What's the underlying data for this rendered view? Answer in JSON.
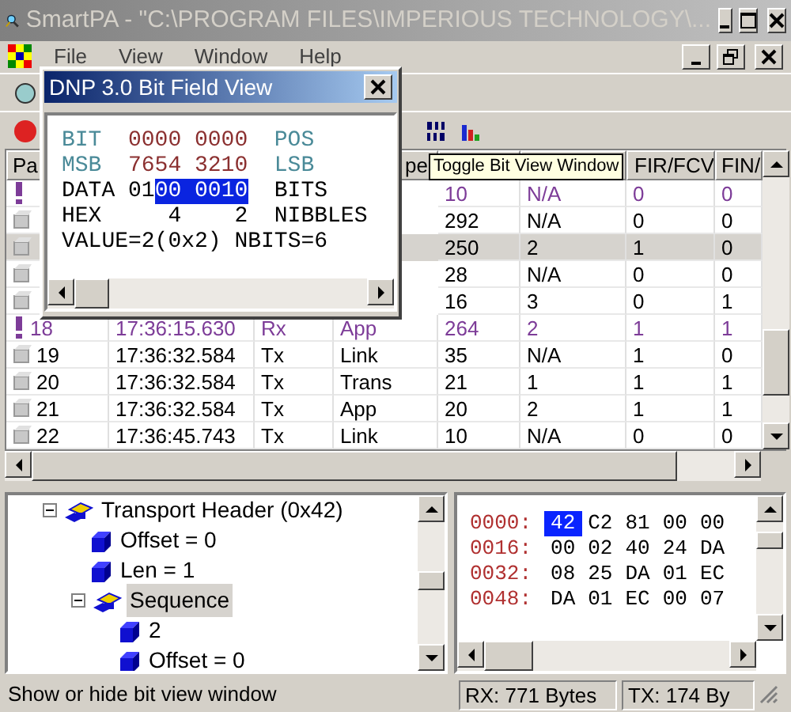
{
  "window": {
    "title": "SmartPA - \"C:\\PROGRAM FILES\\IMPERIOUS TECHNOLOGY\\...",
    "active": false
  },
  "menu": [
    "File",
    "View",
    "Window",
    "Help"
  ],
  "packet_list": {
    "columns": [
      {
        "label": "Pa"
      },
      {},
      {},
      {
        "label": "pe"
      },
      {},
      {},
      {
        "label": "FIR/FCV"
      },
      {
        "label": "FIN/"
      }
    ],
    "rows": [
      {
        "kind": "rx",
        "selected": false,
        "length": "10",
        "sequence": "N/A",
        "fir_fcv": "0",
        "fin": "0"
      },
      {
        "kind": "tx",
        "selected": false,
        "length": "292",
        "sequence": "N/A",
        "fir_fcv": "0",
        "fin": "0"
      },
      {
        "kind": "tx",
        "selected": true,
        "length": "250",
        "sequence": "2",
        "fir_fcv": "1",
        "fin": "0"
      },
      {
        "kind": "tx",
        "selected": false,
        "length": "28",
        "sequence": "N/A",
        "fir_fcv": "0",
        "fin": "0"
      },
      {
        "kind": "tx",
        "selected": false,
        "length": "16",
        "sequence": "3",
        "fir_fcv": "0",
        "fin": "1"
      },
      {
        "kind": "rx",
        "selected": false,
        "number": "18",
        "time": "17:36:15.630",
        "direction": "Rx",
        "layer": "App",
        "length": "264",
        "sequence": "2",
        "fir_fcv": "1",
        "fin": "1"
      },
      {
        "kind": "tx",
        "selected": false,
        "number": "19",
        "time": "17:36:32.584",
        "direction": "Tx",
        "layer": "Link",
        "length": "35",
        "sequence": "N/A",
        "fir_fcv": "1",
        "fin": "0"
      },
      {
        "kind": "tx",
        "selected": false,
        "number": "20",
        "time": "17:36:32.584",
        "direction": "Tx",
        "layer": "Trans",
        "length": "21",
        "sequence": "1",
        "fir_fcv": "1",
        "fin": "1"
      },
      {
        "kind": "tx",
        "selected": false,
        "number": "21",
        "time": "17:36:32.584",
        "direction": "Tx",
        "layer": "App",
        "length": "20",
        "sequence": "2",
        "fir_fcv": "1",
        "fin": "1"
      },
      {
        "kind": "tx",
        "selected": false,
        "number": "22",
        "time": "17:36:45.743",
        "direction": "Tx",
        "layer": "Link",
        "length": "10",
        "sequence": "N/A",
        "fir_fcv": "0",
        "fin": "0"
      }
    ]
  },
  "bit_view": {
    "title": "DNP 3.0 Bit Field View",
    "active": true,
    "lines": [
      {
        "label": {
          "text": "BIT",
          "kind": "caption"
        },
        "value": [
          {
            "text": "0000 0000",
            "kind": "digits"
          }
        ],
        "unit": {
          "text": "POS",
          "kind": "caption"
        }
      },
      {
        "label": {
          "text": "MSB",
          "kind": "caption"
        },
        "value": [
          {
            "text": "7654 3210",
            "kind": "digits"
          }
        ],
        "unit": {
          "text": "LSB",
          "kind": "caption"
        }
      },
      {
        "label": {
          "text": "DATA",
          "kind": "text"
        },
        "value": [
          {
            "text": "01",
            "kind": "text"
          },
          {
            "text": "00 0010",
            "kind": "highlight"
          }
        ],
        "unit": {
          "text": "BITS",
          "kind": "text"
        }
      },
      {
        "label": {
          "text": "HEX",
          "kind": "text"
        },
        "value": [
          {
            "text": "4",
            "kind": "nibble"
          },
          {
            "text": "2",
            "kind": "nibble"
          }
        ],
        "unit": {
          "text": "NIBBLES",
          "kind": "text"
        }
      },
      {
        "summary": "VALUE=2(0x2) NBITS=6"
      }
    ]
  },
  "tooltip": "Toggle Bit View Window",
  "tree": [
    {
      "label": "Transport Header (0x42)",
      "kind": "group",
      "expanded": true,
      "selected": false,
      "children": [
        {
          "label": "Offset = 0",
          "kind": "leaf",
          "selected": false
        },
        {
          "label": "Len = 1",
          "kind": "leaf",
          "selected": false
        },
        {
          "label": "Sequence",
          "kind": "group",
          "expanded": true,
          "selected": true,
          "children": [
            {
              "label": "2",
              "kind": "leaf",
              "selected": false
            },
            {
              "label": "Offset = 0",
              "kind": "leaf",
              "selected": false
            }
          ]
        }
      ]
    }
  ],
  "hex_view": [
    {
      "offset": "0000:",
      "bytes": [
        {
          "text": "42",
          "selected": true
        },
        {
          "text": "C2",
          "selected": false
        },
        {
          "text": "81",
          "selected": false
        },
        {
          "text": "00",
          "selected": false
        },
        {
          "text": "00",
          "selected": false
        }
      ]
    },
    {
      "offset": "0016:",
      "bytes": [
        {
          "text": "00",
          "selected": false
        },
        {
          "text": "02",
          "selected": false
        },
        {
          "text": "40",
          "selected": false
        },
        {
          "text": "24",
          "selected": false
        },
        {
          "text": "DA",
          "selected": false
        }
      ]
    },
    {
      "offset": "0032:",
      "bytes": [
        {
          "text": "08",
          "selected": false
        },
        {
          "text": "25",
          "selected": false
        },
        {
          "text": "DA",
          "selected": false
        },
        {
          "text": "01",
          "selected": false
        },
        {
          "text": "EC",
          "selected": false
        }
      ]
    },
    {
      "offset": "0048:",
      "bytes": [
        {
          "text": "DA",
          "selected": false
        },
        {
          "text": "01",
          "selected": false
        },
        {
          "text": "EC",
          "selected": false
        },
        {
          "text": "00",
          "selected": false
        },
        {
          "text": "07",
          "selected": false
        }
      ]
    }
  ],
  "status_bar": [
    "Show or hide bit view window",
    "RX: 771 Bytes",
    "TX: 174 By"
  ]
}
